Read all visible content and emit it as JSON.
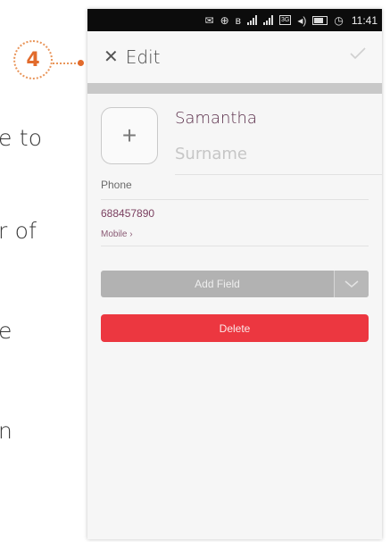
{
  "side_text": {
    "line1": "e to",
    "line2": "r of",
    "line3": "e",
    "line4": "n"
  },
  "callout": {
    "number": "4"
  },
  "status_bar": {
    "time": "11:41"
  },
  "header": {
    "title": "Edit"
  },
  "contact": {
    "first_name": "Samantha",
    "surname_placeholder": "Surname",
    "phone_label": "Phone",
    "phone_number": "688457890",
    "phone_type": "Mobile ›"
  },
  "buttons": {
    "add_field": "Add Field",
    "delete": "Delete"
  },
  "colors": {
    "delete": "#ec3740",
    "callout": "#e26b2c",
    "add_field": "#b2b2b2"
  },
  "icons": {
    "close": "close-icon",
    "confirm": "checkmark-icon",
    "avatar": "plus-icon",
    "dropdown": "chevron-down-icon"
  }
}
